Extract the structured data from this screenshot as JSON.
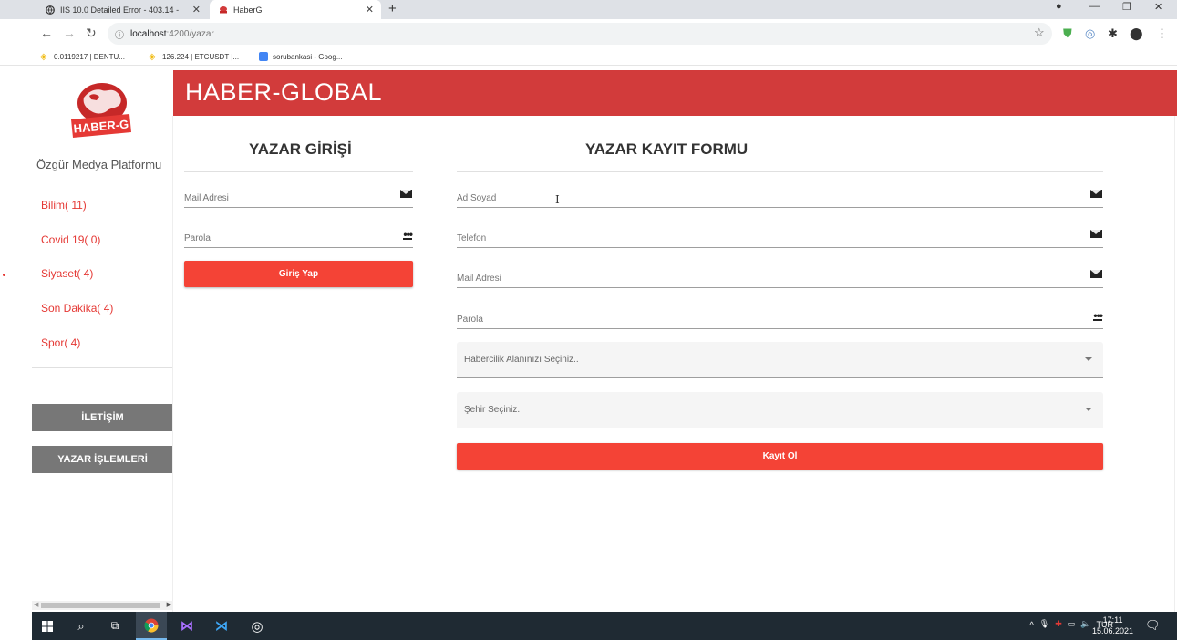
{
  "browser": {
    "tabs": [
      {
        "title": "IIS 10.0 Detailed Error - 403.14 -",
        "active": false
      },
      {
        "title": "HaberG",
        "active": true
      }
    ],
    "new_tab": "+",
    "url_host": "localhost",
    "url_path": ":4200/yazar",
    "bookmarks": [
      {
        "label": "0.0119217 | DENTU..."
      },
      {
        "label": "126.224 | ETCUSDT |..."
      },
      {
        "label": "sorubankasi - Goog..."
      }
    ]
  },
  "sidebar": {
    "logo_text": "HABER-G",
    "platform": "Özgür Medya Platformu",
    "categories": [
      {
        "label": "Bilim( 11)"
      },
      {
        "label": "Covid 19( 0)"
      },
      {
        "label": "Siyaset( 4)"
      },
      {
        "label": "Son Dakika( 4)"
      },
      {
        "label": "Spor( 4)"
      }
    ],
    "contact_button": "İLETİŞİM",
    "author_button": "YAZAR İŞLEMLERİ"
  },
  "header": {
    "title": "HABER-GLOBAL"
  },
  "login": {
    "title": "YAZAR GİRİŞİ",
    "email_label": "Mail Adresi",
    "password_label": "Parola",
    "submit": "Giriş Yap"
  },
  "register": {
    "title": "YAZAR KAYIT FORMU",
    "name_label": "Ad Soyad",
    "phone_label": "Telefon",
    "email_label": "Mail Adresi",
    "password_label": "Parola",
    "field_select": "Habercilik Alanınızı Seçiniz..",
    "city_select": "Şehir Seçiniz..",
    "submit": "Kayıt Ol"
  },
  "taskbar": {
    "lang": "TUR",
    "time": "17:11",
    "date": "15.06.2021"
  },
  "colors": {
    "brand_red": "#d23b3b",
    "button_red": "#f44336",
    "sidebar_gray": "#777777"
  }
}
